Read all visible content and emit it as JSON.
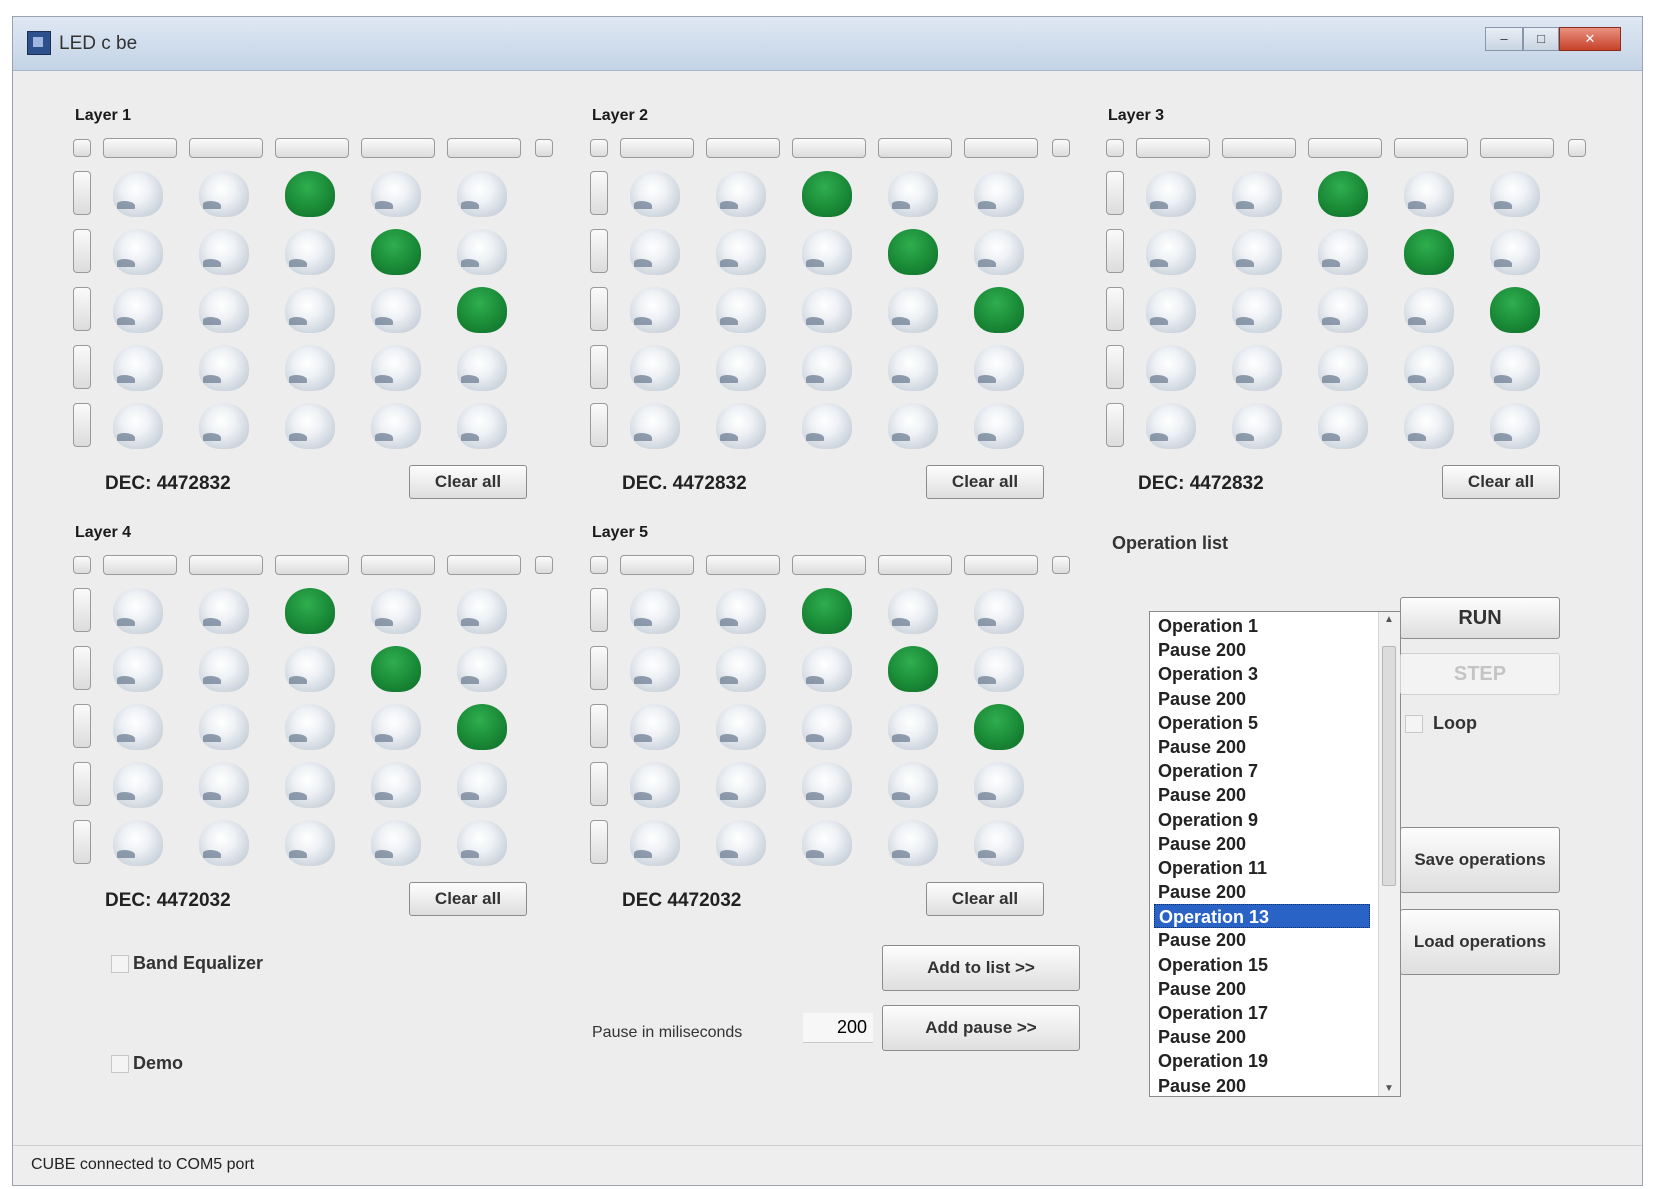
{
  "window": {
    "title": "LED c be"
  },
  "layers": [
    {
      "title": "Layer 1",
      "dec": "DEC: 4472832",
      "clear_label": "Clear all",
      "leds": [
        [
          0,
          0,
          1,
          0,
          0
        ],
        [
          0,
          0,
          0,
          1,
          0
        ],
        [
          0,
          0,
          0,
          0,
          1
        ],
        [
          0,
          0,
          0,
          0,
          0
        ],
        [
          0,
          0,
          0,
          0,
          0
        ]
      ]
    },
    {
      "title": "Layer 2",
      "dec": "DEC. 4472832",
      "clear_label": "Clear all",
      "leds": [
        [
          0,
          0,
          1,
          0,
          0
        ],
        [
          0,
          0,
          0,
          1,
          0
        ],
        [
          0,
          0,
          0,
          0,
          1
        ],
        [
          0,
          0,
          0,
          0,
          0
        ],
        [
          0,
          0,
          0,
          0,
          0
        ]
      ]
    },
    {
      "title": "Layer 3",
      "dec": "DEC: 4472832",
      "clear_label": "Clear all",
      "leds": [
        [
          0,
          0,
          1,
          0,
          0
        ],
        [
          0,
          0,
          0,
          1,
          0
        ],
        [
          0,
          0,
          0,
          0,
          1
        ],
        [
          0,
          0,
          0,
          0,
          0
        ],
        [
          0,
          0,
          0,
          0,
          0
        ]
      ]
    },
    {
      "title": "Layer 4",
      "dec": "DEC: 4472032",
      "clear_label": "Clear all",
      "leds": [
        [
          0,
          0,
          1,
          0,
          0
        ],
        [
          0,
          0,
          0,
          1,
          0
        ],
        [
          0,
          0,
          0,
          0,
          1
        ],
        [
          0,
          0,
          0,
          0,
          0
        ],
        [
          0,
          0,
          0,
          0,
          0
        ]
      ]
    },
    {
      "title": "Layer 5",
      "dec": "DEC 4472032",
      "clear_label": "Clear all",
      "leds": [
        [
          0,
          0,
          1,
          0,
          0
        ],
        [
          0,
          0,
          0,
          1,
          0
        ],
        [
          0,
          0,
          0,
          0,
          1
        ],
        [
          0,
          0,
          0,
          0,
          0
        ],
        [
          0,
          0,
          0,
          0,
          0
        ]
      ]
    }
  ],
  "operations": {
    "title": "Operation list",
    "items": [
      "Operation 1",
      "Pause 200",
      "Operation 3",
      "Pause 200",
      "Operation 5",
      "Pause 200",
      "Operation 7",
      "Pause 200",
      "Operation 9",
      "Pause 200",
      "Operation 11",
      "Pause 200",
      "Operation 13",
      "Pause 200",
      "Operation 15",
      "Pause 200",
      "Operation 17",
      "Pause 200",
      "Operation 19",
      "Pause 200"
    ],
    "selected_index": 12
  },
  "controls": {
    "run_label": "RUN",
    "step_label": "STEP",
    "loop_label": "Loop",
    "save_label": "Save operations",
    "load_label": "Load operations",
    "add_list_label": "Add to list >>",
    "add_pause_label": "Add pause >>",
    "pause_label": "Pause in miliseconds",
    "pause_value": "200",
    "band_equalizer_label": "Band Equalizer",
    "demo_label": "Demo"
  },
  "status": {
    "text": "CUBE connected to COM5 port"
  }
}
